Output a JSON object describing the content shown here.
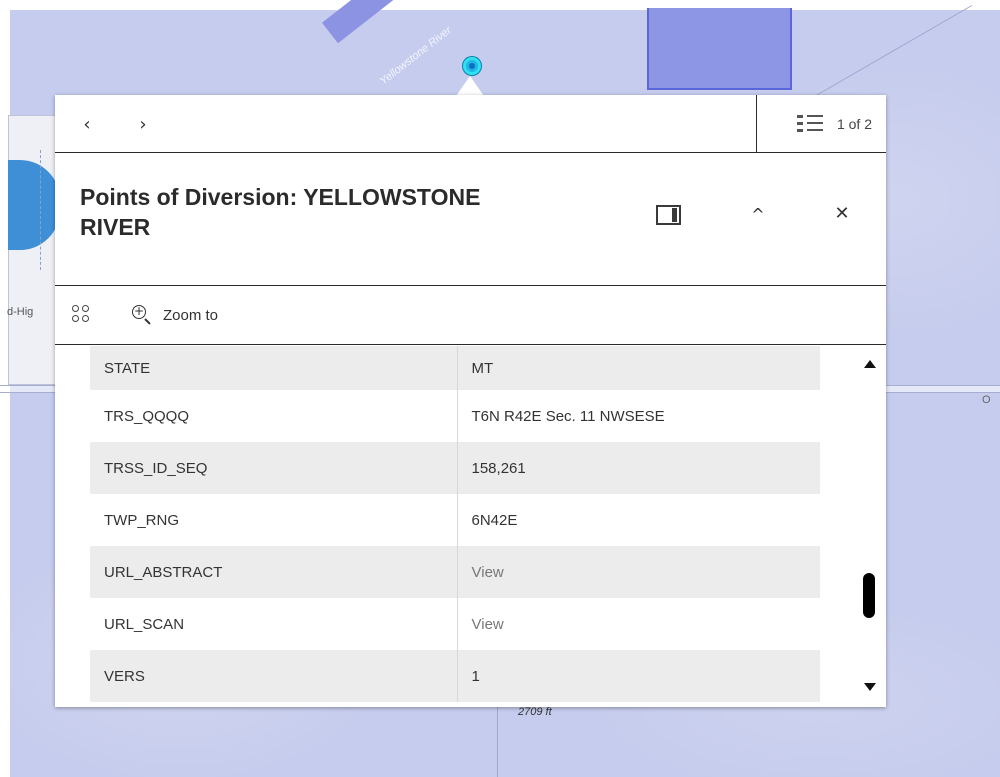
{
  "map": {
    "river_label": "Yellowstone River",
    "road_label_left": "d-Hig",
    "road_label_right": "O",
    "elevation_label": "2709 ft"
  },
  "popup": {
    "nav": {
      "prev_icon": "chevron-left-icon",
      "next_icon": "chevron-right-icon"
    },
    "pager": {
      "text": "1 of 2",
      "icon": "list-icon"
    },
    "title": "Points of Diversion: YELLOWSTONE RIVER",
    "actions": {
      "more_icon": "options-grid-icon",
      "zoom_label": "Zoom to"
    },
    "attributes": [
      {
        "key": "STATE",
        "value": "MT",
        "is_link": false
      },
      {
        "key": "TRS_QQQQ",
        "value": "T6N R42E Sec. 11 NWSESE",
        "is_link": false
      },
      {
        "key": "TRSS_ID_SEQ",
        "value": "158,261",
        "is_link": false
      },
      {
        "key": "TWP_RNG",
        "value": "6N42E",
        "is_link": false
      },
      {
        "key": "URL_ABSTRACT",
        "value": "View",
        "is_link": true
      },
      {
        "key": "URL_SCAN",
        "value": "View",
        "is_link": true
      },
      {
        "key": "VERS",
        "value": "1",
        "is_link": false
      }
    ]
  },
  "colors": {
    "map_background": "#c6cced",
    "parcel_fill": "#8d95e5",
    "marker": "#1fb6e6",
    "row_shade": "#ececec"
  }
}
